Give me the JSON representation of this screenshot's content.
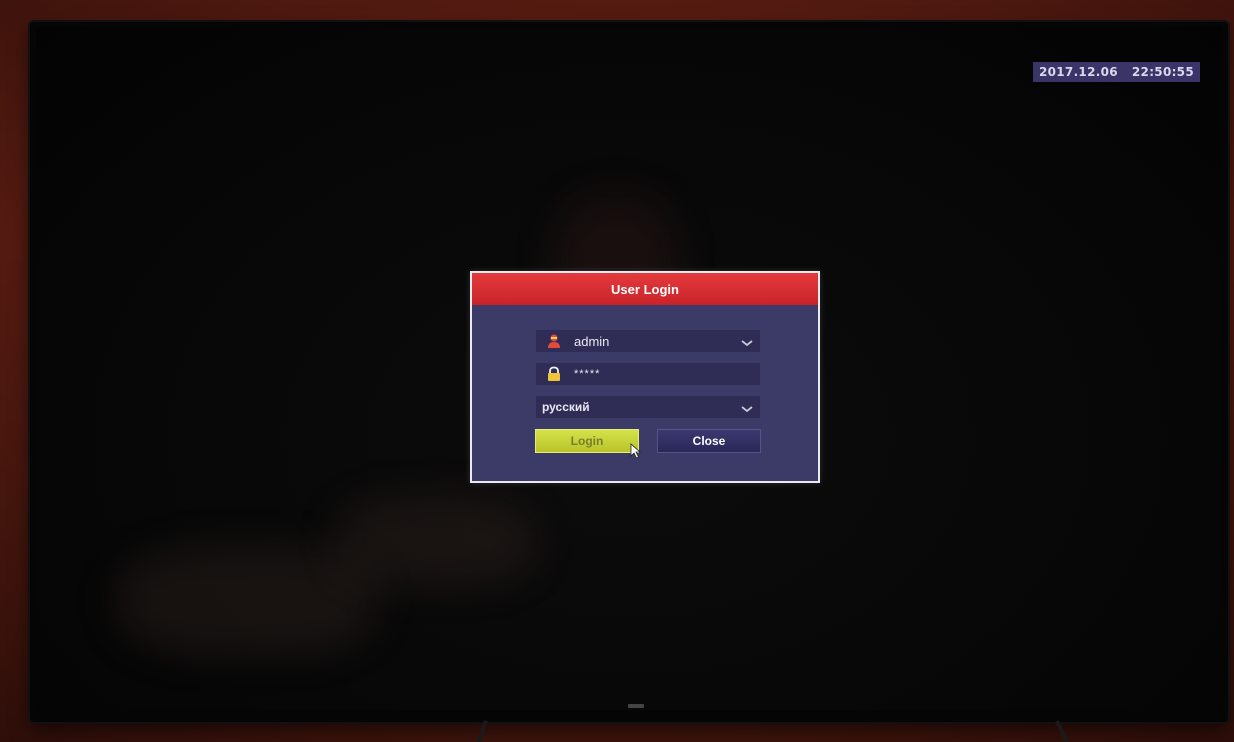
{
  "osd": {
    "date": "2017.12.06",
    "time": "22:50:55"
  },
  "dialog": {
    "title": "User Login",
    "username": "admin",
    "password_mask": "*****",
    "language": "русский",
    "login_label": "Login",
    "close_label": "Close"
  },
  "colors": {
    "header": "#d22a2f",
    "panel": "#3c3a66",
    "field": "#2f2d55",
    "login_button": "#c8d43a",
    "close_button": "#302e62",
    "clock_bg": "#3a3566"
  },
  "icons": {
    "user": "user-icon",
    "password": "lock-icon",
    "dropdown": "chevron-down-icon",
    "pointer": "mouse-cursor-icon"
  }
}
